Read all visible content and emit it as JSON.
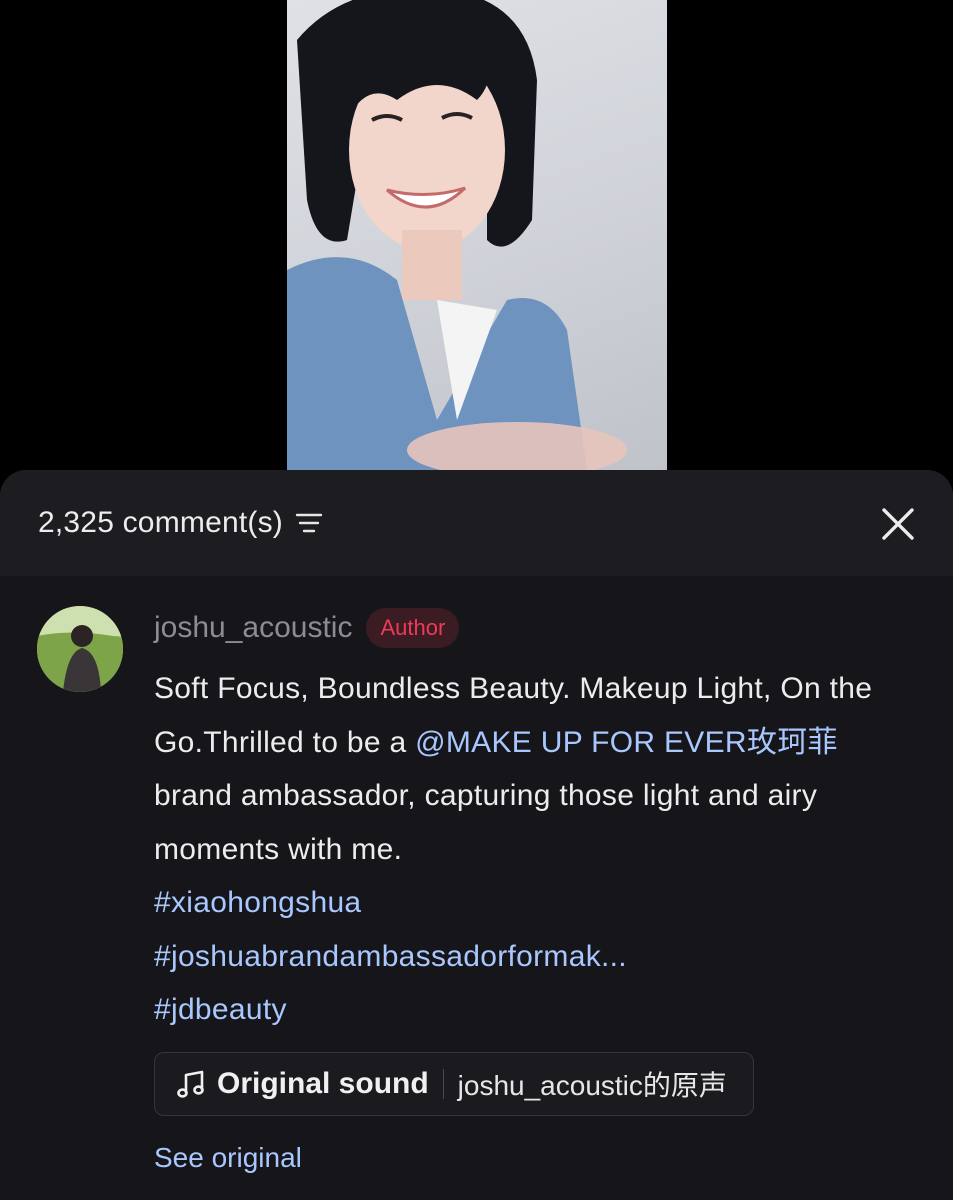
{
  "header": {
    "comment_count": "2,325 comment(s)"
  },
  "icons": {
    "sort": "sort-icon",
    "close": "close-icon",
    "music_note": "music-note-icon"
  },
  "comment": {
    "username": "joshu_acoustic",
    "badge": "Author",
    "caption_before": "Soft Focus, Boundless Beauty. Makeup Light, On the Go.Thrilled to be a ",
    "mention": "@MAKE UP FOR EVER玫珂菲",
    "caption_after": " brand ambassador, capturing those light and airy moments with me.",
    "hashtags": [
      "#xiaohongshua",
      "#joshuabrandambassadorformak...",
      "#jdbeauty"
    ],
    "sound": {
      "label": "Original sound",
      "source": "joshu_acoustic的原声"
    },
    "see_original": "See original"
  },
  "colors": {
    "badge_text": "#ee3a57",
    "link": "#a9c7ff",
    "sheet_bg": "#16161a"
  }
}
